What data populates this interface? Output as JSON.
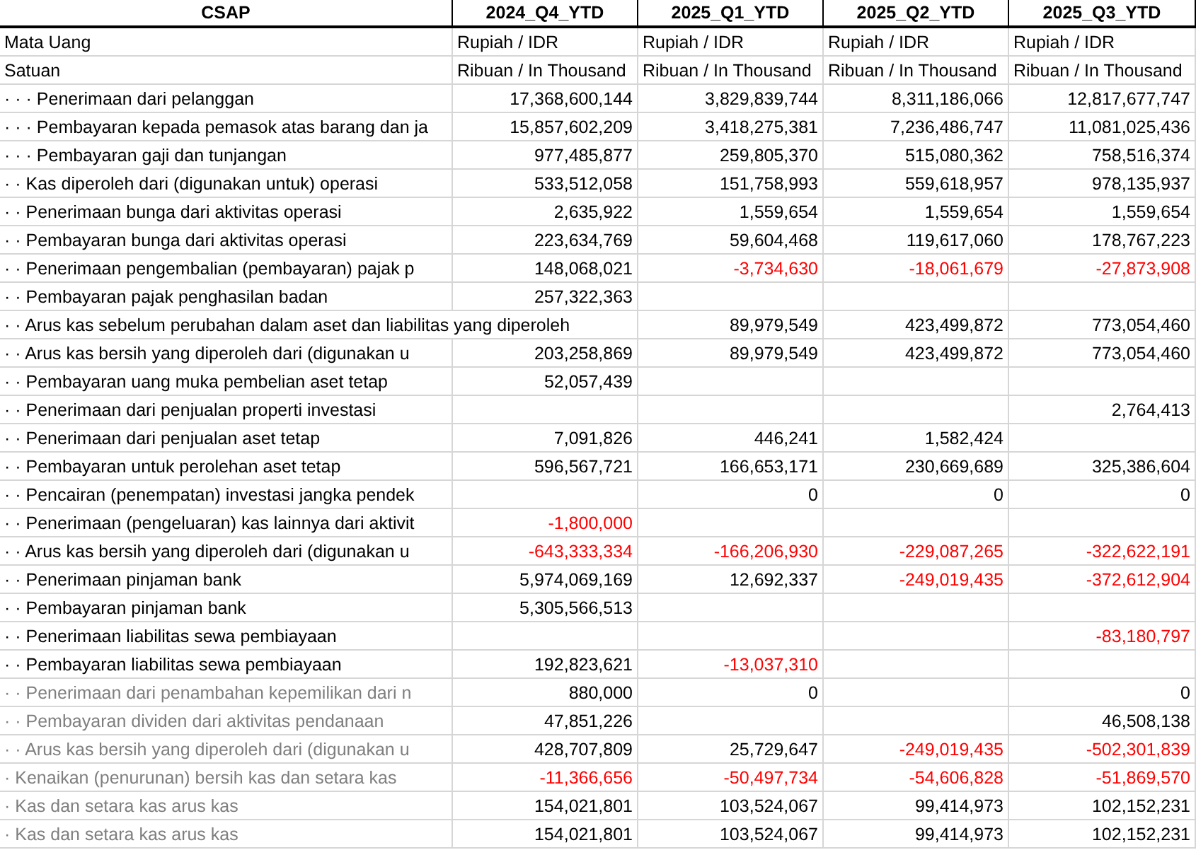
{
  "table": {
    "label_column": "CSAP",
    "columns": [
      "2024_Q4_YTD",
      "2025_Q1_YTD",
      "2025_Q2_YTD",
      "2025_Q3_YTD"
    ],
    "meta_rows": [
      {
        "label": "Mata Uang",
        "values": [
          "Rupiah / IDR",
          "Rupiah / IDR",
          "Rupiah / IDR",
          "Rupiah / IDR"
        ]
      },
      {
        "label": "Satuan",
        "values": [
          "Ribuan / In Thousand",
          "Ribuan / In Thousand",
          "Ribuan / In Thousand",
          "Ribuan / In Thousand"
        ]
      }
    ],
    "rows": [
      {
        "label": "· · · Penerimaan dari pelanggan",
        "dimmed": false,
        "cells": [
          {
            "value": "17,368,600,144",
            "negative": false
          },
          {
            "value": "3,829,839,744",
            "negative": false
          },
          {
            "value": "8,311,186,066",
            "negative": false
          },
          {
            "value": "12,817,677,747",
            "negative": false
          }
        ]
      },
      {
        "label": "· · · Pembayaran kepada pemasok atas barang dan ja",
        "dimmed": false,
        "cells": [
          {
            "value": "15,857,602,209",
            "negative": false
          },
          {
            "value": "3,418,275,381",
            "negative": false
          },
          {
            "value": "7,236,486,747",
            "negative": false
          },
          {
            "value": "11,081,025,436",
            "negative": false
          }
        ]
      },
      {
        "label": "· · · Pembayaran gaji dan tunjangan",
        "dimmed": false,
        "cells": [
          {
            "value": "977,485,877",
            "negative": false
          },
          {
            "value": "259,805,370",
            "negative": false
          },
          {
            "value": "515,080,362",
            "negative": false
          },
          {
            "value": "758,516,374",
            "negative": false
          }
        ]
      },
      {
        "label": "· · Kas diperoleh dari (digunakan untuk) operasi",
        "dimmed": false,
        "cells": [
          {
            "value": "533,512,058",
            "negative": false
          },
          {
            "value": "151,758,993",
            "negative": false
          },
          {
            "value": "559,618,957",
            "negative": false
          },
          {
            "value": "978,135,937",
            "negative": false
          }
        ]
      },
      {
        "label": "· · Penerimaan bunga dari aktivitas operasi",
        "dimmed": false,
        "cells": [
          {
            "value": "2,635,922",
            "negative": false
          },
          {
            "value": "1,559,654",
            "negative": false
          },
          {
            "value": "1,559,654",
            "negative": false
          },
          {
            "value": "1,559,654",
            "negative": false
          }
        ]
      },
      {
        "label": "· · Pembayaran bunga dari aktivitas operasi",
        "dimmed": false,
        "cells": [
          {
            "value": "223,634,769",
            "negative": false
          },
          {
            "value": "59,604,468",
            "negative": false
          },
          {
            "value": "119,617,060",
            "negative": false
          },
          {
            "value": "178,767,223",
            "negative": false
          }
        ]
      },
      {
        "label": "· · Penerimaan pengembalian (pembayaran) pajak p",
        "dimmed": false,
        "cells": [
          {
            "value": "148,068,021",
            "negative": false
          },
          {
            "value": "-3,734,630",
            "negative": true
          },
          {
            "value": "-18,061,679",
            "negative": true
          },
          {
            "value": "-27,873,908",
            "negative": true
          }
        ]
      },
      {
        "label": "· · Pembayaran pajak penghasilan badan",
        "dimmed": false,
        "cells": [
          {
            "value": "257,322,363",
            "negative": false
          },
          null,
          null,
          null
        ]
      },
      {
        "label": "· · Arus kas sebelum perubahan dalam aset dan liabilitas yang diperoleh",
        "dimmed": false,
        "cells": [
          null,
          {
            "value": "89,979,549",
            "negative": false
          },
          {
            "value": "423,499,872",
            "negative": false
          },
          {
            "value": "773,054,460",
            "negative": false
          }
        ]
      },
      {
        "label": "· · Arus kas bersih yang diperoleh dari (digunakan u",
        "dimmed": false,
        "cells": [
          {
            "value": "203,258,869",
            "negative": false
          },
          {
            "value": "89,979,549",
            "negative": false
          },
          {
            "value": "423,499,872",
            "negative": false
          },
          {
            "value": "773,054,460",
            "negative": false
          }
        ]
      },
      {
        "label": "· · Pembayaran uang muka pembelian aset tetap",
        "dimmed": false,
        "cells": [
          {
            "value": "52,057,439",
            "negative": false
          },
          null,
          null,
          null
        ]
      },
      {
        "label": "· · Penerimaan dari penjualan properti investasi",
        "dimmed": false,
        "cells": [
          null,
          null,
          null,
          {
            "value": "2,764,413",
            "negative": false
          }
        ]
      },
      {
        "label": "· · Penerimaan dari penjualan aset tetap",
        "dimmed": false,
        "cells": [
          {
            "value": "7,091,826",
            "negative": false
          },
          {
            "value": "446,241",
            "negative": false
          },
          {
            "value": "1,582,424",
            "negative": false
          },
          null
        ]
      },
      {
        "label": "· · Pembayaran untuk perolehan aset tetap",
        "dimmed": false,
        "cells": [
          {
            "value": "596,567,721",
            "negative": false
          },
          {
            "value": "166,653,171",
            "negative": false
          },
          {
            "value": "230,669,689",
            "negative": false
          },
          {
            "value": "325,386,604",
            "negative": false
          }
        ]
      },
      {
        "label": "· · Pencairan (penempatan) investasi jangka pendek",
        "dimmed": false,
        "cells": [
          null,
          {
            "value": "0",
            "negative": false
          },
          {
            "value": "0",
            "negative": false
          },
          {
            "value": "0",
            "negative": false
          }
        ]
      },
      {
        "label": "· · Penerimaan (pengeluaran) kas lainnya dari aktivit",
        "dimmed": false,
        "cells": [
          {
            "value": "-1,800,000",
            "negative": true
          },
          null,
          null,
          null
        ]
      },
      {
        "label": "· · Arus kas bersih yang diperoleh dari (digunakan u",
        "dimmed": false,
        "cells": [
          {
            "value": "-643,333,334",
            "negative": true
          },
          {
            "value": "-166,206,930",
            "negative": true
          },
          {
            "value": "-229,087,265",
            "negative": true
          },
          {
            "value": "-322,622,191",
            "negative": true
          }
        ]
      },
      {
        "label": "· · Penerimaan pinjaman bank",
        "dimmed": false,
        "cells": [
          {
            "value": "5,974,069,169",
            "negative": false
          },
          {
            "value": "12,692,337",
            "negative": false
          },
          {
            "value": "-249,019,435",
            "negative": true
          },
          {
            "value": "-372,612,904",
            "negative": true
          }
        ]
      },
      {
        "label": "· · Pembayaran pinjaman bank",
        "dimmed": false,
        "cells": [
          {
            "value": "5,305,566,513",
            "negative": false
          },
          null,
          null,
          null
        ]
      },
      {
        "label": "· · Penerimaan liabilitas sewa pembiayaan",
        "dimmed": false,
        "cells": [
          null,
          null,
          null,
          {
            "value": "-83,180,797",
            "negative": true
          }
        ]
      },
      {
        "label": "· · Pembayaran liabilitas sewa pembiayaan",
        "dimmed": false,
        "cells": [
          {
            "value": "192,823,621",
            "negative": false
          },
          {
            "value": "-13,037,310",
            "negative": true
          },
          null,
          null
        ]
      },
      {
        "label": "· · Penerimaan dari penambahan kepemilikan dari n",
        "dimmed": true,
        "cells": [
          {
            "value": "880,000",
            "negative": false
          },
          {
            "value": "0",
            "negative": false
          },
          null,
          {
            "value": "0",
            "negative": false
          }
        ]
      },
      {
        "label": "· · Pembayaran dividen dari aktivitas pendanaan",
        "dimmed": true,
        "cells": [
          {
            "value": "47,851,226",
            "negative": false
          },
          null,
          null,
          {
            "value": "46,508,138",
            "negative": false
          }
        ]
      },
      {
        "label": "· · Arus kas bersih yang diperoleh dari (digunakan u",
        "dimmed": true,
        "cells": [
          {
            "value": "428,707,809",
            "negative": false
          },
          {
            "value": "25,729,647",
            "negative": false
          },
          {
            "value": "-249,019,435",
            "negative": true
          },
          {
            "value": "-502,301,839",
            "negative": true
          }
        ]
      },
      {
        "label": "· Kenaikan (penurunan) bersih kas dan setara kas",
        "dimmed": true,
        "cells": [
          {
            "value": "-11,366,656",
            "negative": true
          },
          {
            "value": "-50,497,734",
            "negative": true
          },
          {
            "value": "-54,606,828",
            "negative": true
          },
          {
            "value": "-51,869,570",
            "negative": true
          }
        ]
      },
      {
        "label": "· Kas dan setara kas arus kas",
        "dimmed": true,
        "cells": [
          {
            "value": "154,021,801",
            "negative": false
          },
          {
            "value": "103,524,067",
            "negative": false
          },
          {
            "value": "99,414,973",
            "negative": false
          },
          {
            "value": "102,152,231",
            "negative": false
          }
        ]
      },
      {
        "label": "· Kas dan setara kas arus kas",
        "dimmed": true,
        "cells": [
          {
            "value": "154,021,801",
            "negative": false
          },
          {
            "value": "103,524,067",
            "negative": false
          },
          {
            "value": "99,414,973",
            "negative": false
          },
          {
            "value": "102,152,231",
            "negative": false
          }
        ]
      }
    ]
  }
}
